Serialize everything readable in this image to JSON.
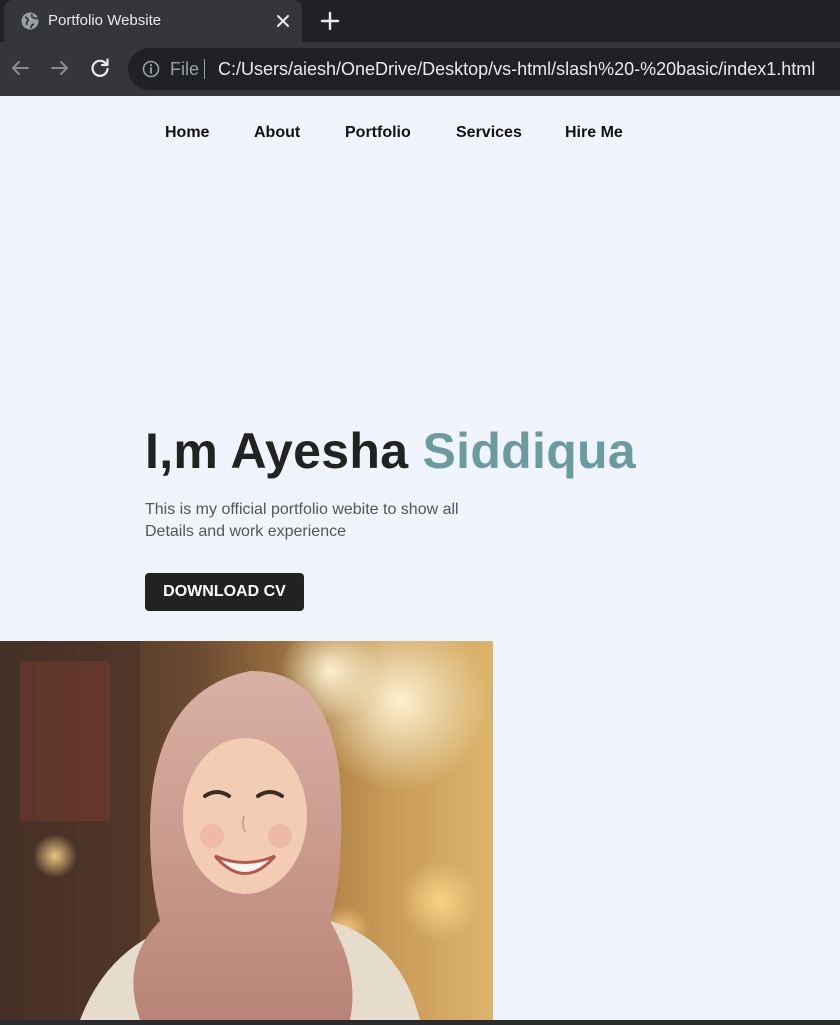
{
  "browser": {
    "tab_title": "Portfolio Website",
    "scheme_label": "File",
    "url": "C:/Users/aiesh/OneDrive/Desktop/vs-html/slash%20-%20basic/index1.html"
  },
  "nav": {
    "items": [
      {
        "label": "Home"
      },
      {
        "label": "About"
      },
      {
        "label": "Portfolio"
      },
      {
        "label": "Services"
      },
      {
        "label": "Hire Me"
      }
    ]
  },
  "hero": {
    "title_main": "I,m Ayesha ",
    "title_accent": "Siddiqua",
    "description": "This is my official portfolio webite to show all Details and work experience",
    "cv_button": "DOWNLOAD CV"
  },
  "colors": {
    "accent": "#6c9b9f",
    "page_bg": "#eff4fd",
    "button_bg": "#222222"
  }
}
